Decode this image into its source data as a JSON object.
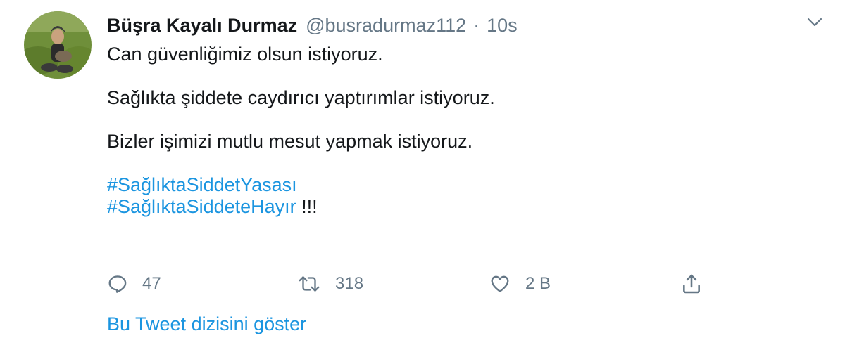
{
  "author": {
    "display_name": "Büşra Kayalı Durmaz",
    "handle": "@busradurmaz112",
    "separator": "·",
    "time": "10s"
  },
  "tweet": {
    "line1": "Can güvenliğimiz olsun istiyoruz.",
    "line2": "Sağlıkta şiddete caydırıcı yaptırımlar istiyoruz.",
    "line3": "Bizler işimizi mutlu mesut yapmak istiyoruz.",
    "hashtag1": "#SağlıktaSiddetYasası",
    "hashtag2": "#SağlıktaSiddeteHayır",
    "hashtag2_suffix": " !!!"
  },
  "actions": {
    "reply_count": "47",
    "retweet_count": "318",
    "like_count": "2 B"
  },
  "thread_link": "Bu Tweet dizisini göster",
  "icons": {
    "caret": "chevron-down-icon",
    "reply": "reply-icon",
    "retweet": "retweet-icon",
    "like": "heart-icon",
    "share": "share-icon"
  },
  "colors": {
    "text": "#14171a",
    "secondary": "#657786",
    "link": "#1b95e0"
  }
}
